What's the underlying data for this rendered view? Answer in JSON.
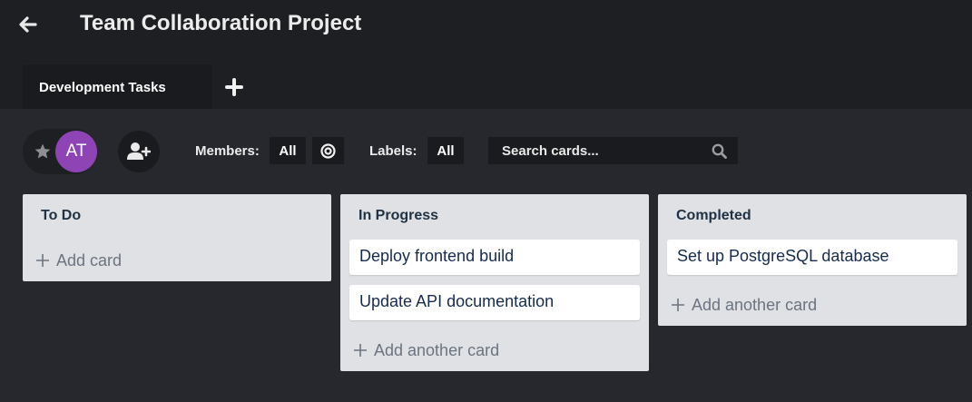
{
  "header": {
    "title": "Team Collaboration Project",
    "back_icon": "arrow-left-icon"
  },
  "tabs": [
    {
      "label": "Development Tasks",
      "active": true
    }
  ],
  "add_tab_icon": "plus-icon",
  "toolbar": {
    "star_icon": "star-icon",
    "avatar_initials": "AT",
    "avatar_color": "#8e44b5",
    "add_member_icon": "user-plus-icon",
    "members_label": "Members:",
    "members_value": "All",
    "target_icon": "target-icon",
    "labels_label": "Labels:",
    "labels_value": "All",
    "search_placeholder": "Search cards...",
    "search_value": ""
  },
  "lists": [
    {
      "title": "To Do",
      "cards": [],
      "add_label": "Add card"
    },
    {
      "title": "In Progress",
      "cards": [
        "Deploy frontend build",
        "Update API documentation"
      ],
      "add_label": "Add another card"
    },
    {
      "title": "Completed",
      "cards": [
        "Set up PostgreSQL database"
      ],
      "add_label": "Add another card"
    }
  ],
  "colors": {
    "background": "#26282d",
    "header": "#1e1f23",
    "list": "#dfe1e4",
    "avatar": "#8e44b5"
  }
}
